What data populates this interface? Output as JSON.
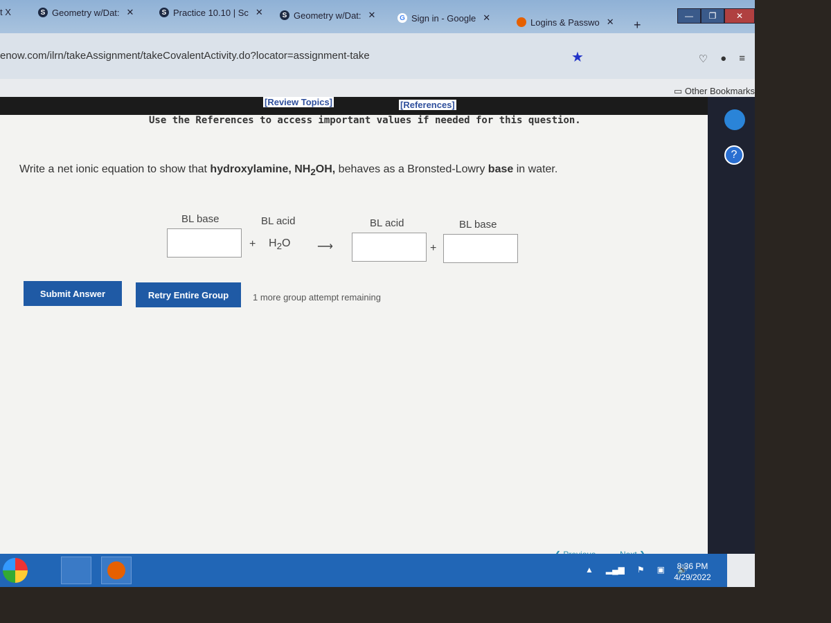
{
  "browser": {
    "tabs": [
      {
        "label": "t X",
        "icon": ""
      },
      {
        "label": "Geometry w/Dat:",
        "icon": "S"
      },
      {
        "label": "Practice 10.10 | Sc",
        "icon": "S"
      },
      {
        "label": "Geometry w/Dat:",
        "icon": "S"
      },
      {
        "label": "Sign in - Google",
        "icon": "G"
      },
      {
        "label": "Logins & Passwo",
        "icon": "firefox"
      }
    ],
    "new_tab": "+",
    "url": "enow.com/ilrn/takeAssignment/takeCovalentActivity.do?locator=assignment-take",
    "bookmarks_label": "Other Bookmarks"
  },
  "page": {
    "review_topics": "[Review Topics]",
    "references": "[References]",
    "ref_note": "Use the References to access important values if needed for this question.",
    "question": {
      "pre": "Write a net ionic equation to show that ",
      "bold": "hydroxylamine, NH",
      "sub": "2",
      "bold2": "OH,",
      "mid": " behaves as a Bronsted-Lowry ",
      "base": "base",
      "post": " in water."
    },
    "equation": {
      "labels": [
        "BL base",
        "BL acid",
        "BL acid",
        "BL base"
      ],
      "plus": "+",
      "water": "H",
      "water_sub": "2",
      "water_o": "O",
      "arrow": "⟶",
      "inputs": [
        "",
        "",
        ""
      ]
    },
    "submit": "Submit Answer",
    "retry": "Retry Entire Group",
    "remaining": "1 more group attempt remaining",
    "previous": "Previous",
    "next": "Next"
  },
  "taskbar": {
    "time": "8:36 PM",
    "date": "4/29/2022"
  }
}
